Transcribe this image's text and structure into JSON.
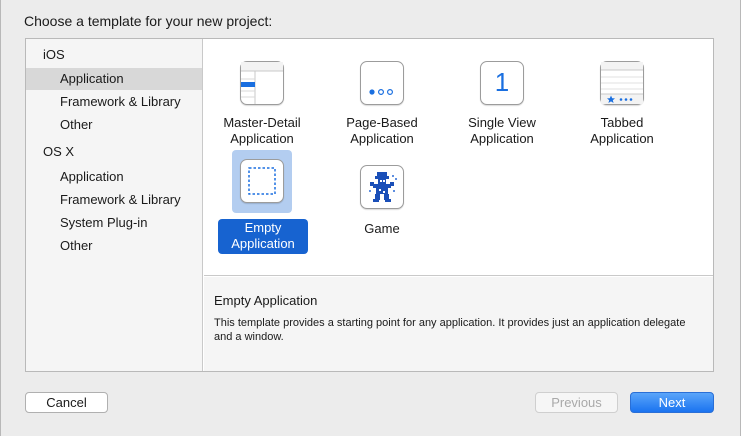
{
  "heading": "Choose a template for your new project:",
  "sidebar": {
    "groups": [
      {
        "title": "iOS",
        "items": [
          "Application",
          "Framework & Library",
          "Other"
        ]
      },
      {
        "title": "OS X",
        "items": [
          "Application",
          "Framework & Library",
          "System Plug-in",
          "Other"
        ]
      }
    ],
    "selected": "iOS/Application"
  },
  "templates": [
    {
      "line1": "Master-Detail",
      "line2": "Application",
      "icon": "master-detail-icon"
    },
    {
      "line1": "Page-Based",
      "line2": "Application",
      "icon": "page-based-icon"
    },
    {
      "line1": "Single View",
      "line2": "Application",
      "icon": "single-view-icon"
    },
    {
      "line1": "Tabbed",
      "line2": "Application",
      "icon": "tabbed-icon"
    },
    {
      "line1": "Empty",
      "line2": "Application",
      "icon": "empty-application-icon",
      "selected": true
    },
    {
      "line1": "Game",
      "line2": "",
      "icon": "game-icon"
    }
  ],
  "single_view_number": "1",
  "detail": {
    "title": "Empty Application",
    "description": "This template provides a starting point for any application. It provides just an application delegate and a window."
  },
  "buttons": {
    "cancel": "Cancel",
    "previous": "Previous",
    "next": "Next"
  },
  "colors": {
    "accent": "#1763d0",
    "icon_blue": "#1a6fe0",
    "selection_bg": "#b3cdf0"
  }
}
